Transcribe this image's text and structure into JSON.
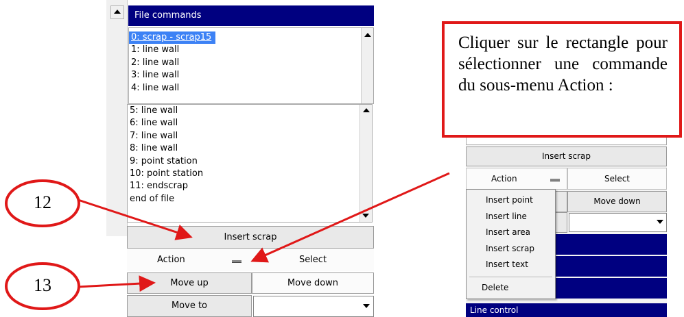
{
  "left_panel": {
    "title": "File commands",
    "list_top": [
      "0: scrap - scrap15",
      "1: line wall",
      "2: line wall",
      "3: line wall",
      "4: line wall"
    ],
    "list_bottom": [
      "5: line wall",
      "6: line wall",
      "7: line wall",
      "8: line wall",
      "9: point station",
      "10: point station",
      "11: endscrap",
      "end of file"
    ],
    "insert_scrap": "Insert scrap",
    "action": "Action",
    "select": "Select",
    "move_up": "Move up",
    "move_down": "Move down",
    "move_to": "Move to"
  },
  "right_panel": {
    "insert_scrap": "Insert scrap",
    "action": "Action",
    "select": "Select",
    "move_down": "Move down",
    "menu_items": [
      "Insert point",
      "Insert line",
      "Insert area",
      "Insert scrap",
      "Insert text"
    ],
    "menu_delete": "Delete",
    "line_control": "Line control"
  },
  "callout": {
    "text": "Cliquer sur le rectangle pour sélectionner une commande du sous-menu Action :"
  },
  "markers": {
    "marker_12": "12",
    "marker_13": "13"
  },
  "colors": {
    "navy": "#000080",
    "selection": "#3d82f5",
    "annotation_red": "#e01818"
  }
}
